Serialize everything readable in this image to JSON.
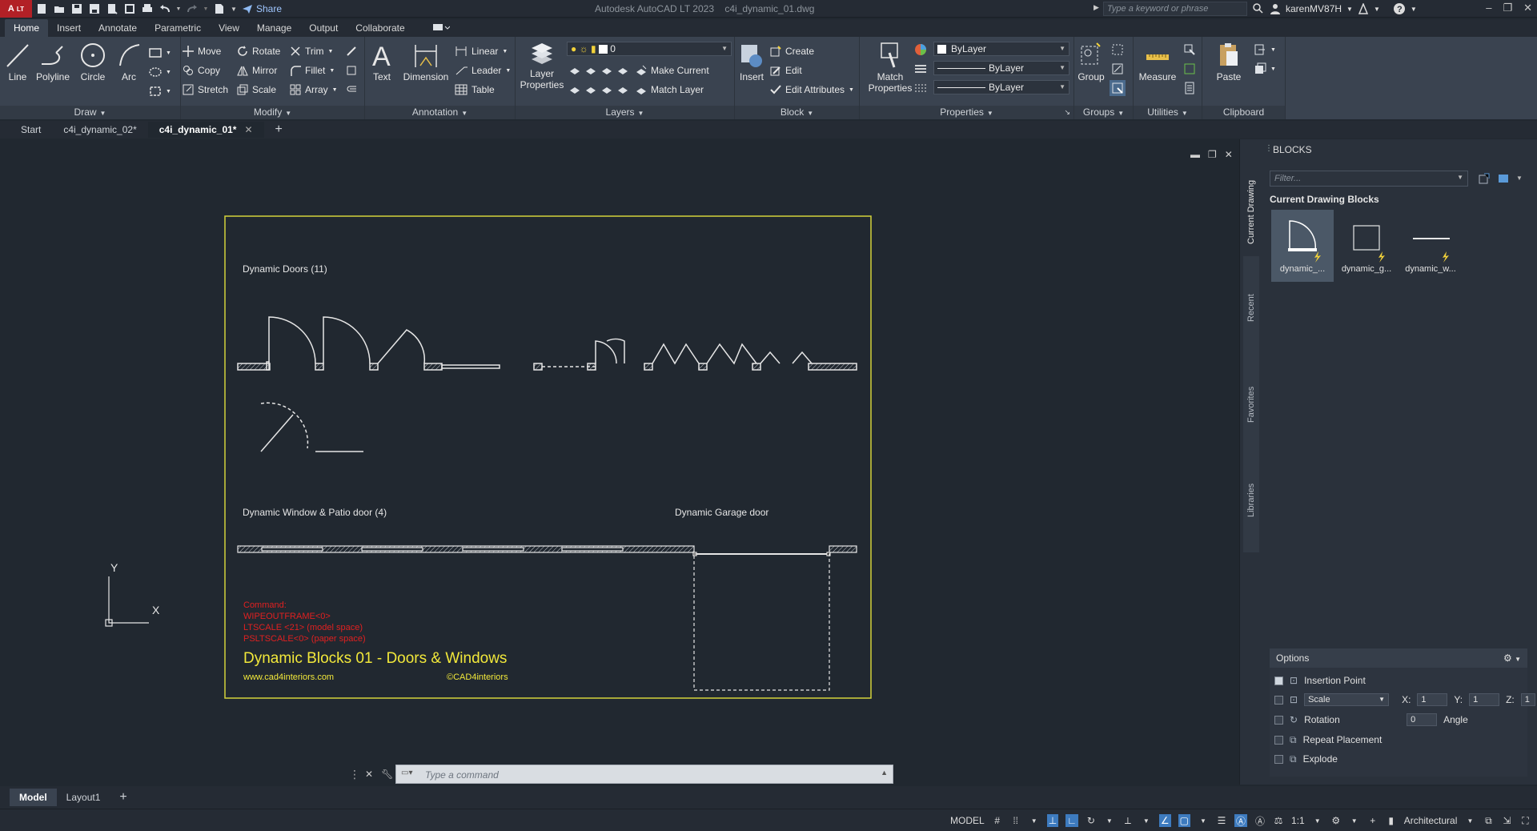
{
  "titlebar": {
    "app_badge": "A",
    "app_badge_sub": "LT",
    "share": "Share",
    "app_name": "Autodesk AutoCAD LT 2023",
    "file_name": "c4i_dynamic_01.dwg",
    "search_placeholder": "Type a keyword or phrase",
    "user": "karenMV87H"
  },
  "menu_tabs": [
    "Home",
    "Insert",
    "Annotate",
    "Parametric",
    "View",
    "Manage",
    "Output",
    "Collaborate"
  ],
  "ribbon": {
    "draw": {
      "title": "Draw",
      "line": "Line",
      "polyline": "Polyline",
      "circle": "Circle",
      "arc": "Arc"
    },
    "modify": {
      "title": "Modify",
      "move": "Move",
      "rotate": "Rotate",
      "trim": "Trim",
      "copy": "Copy",
      "mirror": "Mirror",
      "fillet": "Fillet",
      "stretch": "Stretch",
      "scale": "Scale",
      "array": "Array"
    },
    "annotation": {
      "title": "Annotation",
      "text": "Text",
      "dimension": "Dimension",
      "linear": "Linear",
      "leader": "Leader",
      "table": "Table"
    },
    "layers": {
      "title": "Layers",
      "layer_properties": "Layer Properties",
      "current_layer": "0",
      "make_current": "Make Current",
      "match_layer": "Match Layer"
    },
    "block": {
      "title": "Block",
      "insert": "Insert",
      "create": "Create",
      "edit": "Edit",
      "edit_attributes": "Edit Attributes"
    },
    "properties": {
      "title": "Properties",
      "match_properties": "Match Properties",
      "color": "ByLayer",
      "linetype": "ByLayer",
      "lineweight": "ByLayer"
    },
    "groups": {
      "title": "Groups",
      "group": "Group"
    },
    "utilities": {
      "title": "Utilities",
      "measure": "Measure"
    },
    "clipboard": {
      "title": "Clipboard",
      "paste": "Paste"
    }
  },
  "doc_tabs": [
    "Start",
    "c4i_dynamic_02*",
    "c4i_dynamic_01*"
  ],
  "drawing": {
    "label_doors": "Dynamic Doors (11)",
    "label_windows": "Dynamic Window & Patio door (4)",
    "label_garage": "Dynamic Garage door",
    "cmd_lines": [
      "Command:",
      "WIPEOUTFRAME<0>",
      "LTSCALE <21> (model space)",
      "PSLTSCALE<0> (paper space)"
    ],
    "sheet_title": "Dynamic Blocks 01 - Doors & Windows",
    "website": "www.cad4interiors.com",
    "copyright": "©CAD4interiors",
    "ucs_x": "X",
    "ucs_y": "Y"
  },
  "command": {
    "placeholder": "Type a command"
  },
  "palette": {
    "title": "BLOCKS",
    "side_tabs": [
      "Current Drawing",
      "Recent",
      "Favorites",
      "Libraries"
    ],
    "filter_placeholder": "Filter...",
    "section": "Current Drawing Blocks",
    "blocks": [
      "dynamic_...",
      "dynamic_g...",
      "dynamic_w..."
    ],
    "options_title": "Options",
    "options": {
      "insertion_point": "Insertion Point",
      "scale": "Scale",
      "x_label": "X:",
      "x_val": "1",
      "y_label": "Y:",
      "y_val": "1",
      "z_label": "Z:",
      "z_val": "1",
      "rotation": "Rotation",
      "rotation_val": "0",
      "angle": "Angle",
      "repeat": "Repeat Placement",
      "explode": "Explode"
    }
  },
  "layout_tabs": [
    "Model",
    "Layout1"
  ],
  "status": {
    "model": "MODEL",
    "scale": "1:1",
    "units": "Architectural"
  },
  "colors": {
    "accent": "#3d7bbf",
    "frame": "#d4d23a",
    "command_red": "#e02020",
    "title_yellow": "#f2e83a"
  }
}
